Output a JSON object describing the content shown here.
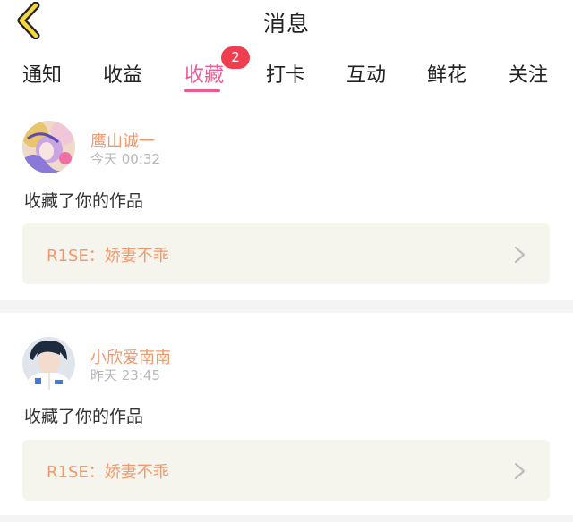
{
  "header": {
    "title": "消息",
    "back_icon": "chevron-left-icon"
  },
  "tabs": [
    {
      "label": "通知"
    },
    {
      "label": "收益"
    },
    {
      "label": "收藏",
      "active": true,
      "badge": "2"
    },
    {
      "label": "打卡"
    },
    {
      "label": "互动"
    },
    {
      "label": "鲜花"
    },
    {
      "label": "关注"
    }
  ],
  "messages": [
    {
      "username": "鹰山诚一",
      "time": "今天 00:32",
      "action": "收藏了你的作品",
      "work": "R1SE：娇妻不乖"
    },
    {
      "username": "小欣爱南南",
      "time": "昨天 23:45",
      "action": "收藏了你的作品",
      "work": "R1SE：娇妻不乖"
    }
  ],
  "colors": {
    "accent": "#ee5b94",
    "badge": "#f03e51",
    "name": "#f2986d",
    "back_arrow": "#f5d83c",
    "box": "#f5f5ee"
  }
}
